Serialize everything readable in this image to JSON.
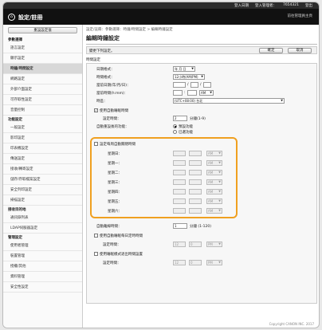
{
  "topbar": {
    "login": "登入日期",
    "user": "登入管理者：",
    "username": "7654321",
    "logout": "登出"
  },
  "header": {
    "title": "設定/註冊",
    "home_icon": "home-icon",
    "mgmt": "前往管理員主頁"
  },
  "sidebar": {
    "top_button": "重設設定值",
    "sections": [
      {
        "title": "參數選擇",
        "items": [
          "語言設定",
          "顯示設定",
          "時鐘/時間設定",
          "網路設定",
          "外部介面設定",
          "可存取性設定",
          "音量控制"
        ]
      },
      {
        "title": "功能設定",
        "items": [
          "一般設定",
          "影印設定",
          "印表機設定",
          "傳送設定",
          "接收/轉寄設定",
          "儲存/存取檔案設定",
          "安全列印設定",
          "掃描設定"
        ]
      },
      {
        "title": "接收目的地",
        "items": [
          "通訊錄列表",
          "LDAP伺服器設定"
        ]
      },
      {
        "title": "管理設定",
        "items": [
          "使用者管理",
          "裝置管理",
          "授權/其他",
          "資料管理",
          "安全性設定"
        ]
      }
    ]
  },
  "main": {
    "breadcrumb": "設定/註冊：參數選擇：時鐘/時間設定 > 編輯時鐘設定",
    "title": "編輯時鐘設定",
    "info": "變更下列設定。",
    "ok": "確定",
    "cancel": "取消",
    "section": "時間設定",
    "date_format_label": "日期格式：",
    "date_format_value": "年 月 日",
    "time_format_label": "時間格式：",
    "time_format_value": "12小時(AM/PM)",
    "current_date_label": "當前日期(年/月/日)：",
    "date_sep1": "/",
    "date_sep2": "/",
    "current_time_label": "當前時間(h:mm)：",
    "time_sep": ":",
    "ampm_value": "AM",
    "timezone_label": "時區：",
    "timezone_value": "(UTC+08:00) 台北",
    "auto_sleep_label": "使用自動睡眠時間",
    "sleep_time_label": "設定時間：",
    "sleep_time_value": "2",
    "sleep_time_unit": "分鐘(1-9)",
    "auto_reset_label": "自動重設後的功能：",
    "auto_reset_opt1": "預設功能",
    "auto_reset_opt2": "已選功能",
    "weekly_label": "設定每周自動關閉時間",
    "days": [
      "星期日：",
      "星期一：",
      "星期二：",
      "星期三：",
      "星期四：",
      "星期五：",
      "星期六："
    ],
    "day_ampm": "AM",
    "auto_offline_label": "自動離線時間：",
    "auto_offline_value": "1",
    "auto_offline_unit": "分鐘 (1-120)",
    "daily_sleep_label": "使用自動睡眠每日定時時間",
    "daily_sleep_time_label": "設定時間：",
    "daily_sleep_hour": "12",
    "daily_sleep_min": "0",
    "daily_sleep_ampm": "PM",
    "daily_wake_label": "使用睡眠模式退出時間設置",
    "daily_wake_time_label": "設定時間：",
    "daily_wake_hour": "12",
    "daily_wake_min": "0",
    "daily_wake_ampm": "PM"
  },
  "copyright": "Copyright CANON INC. 2017"
}
